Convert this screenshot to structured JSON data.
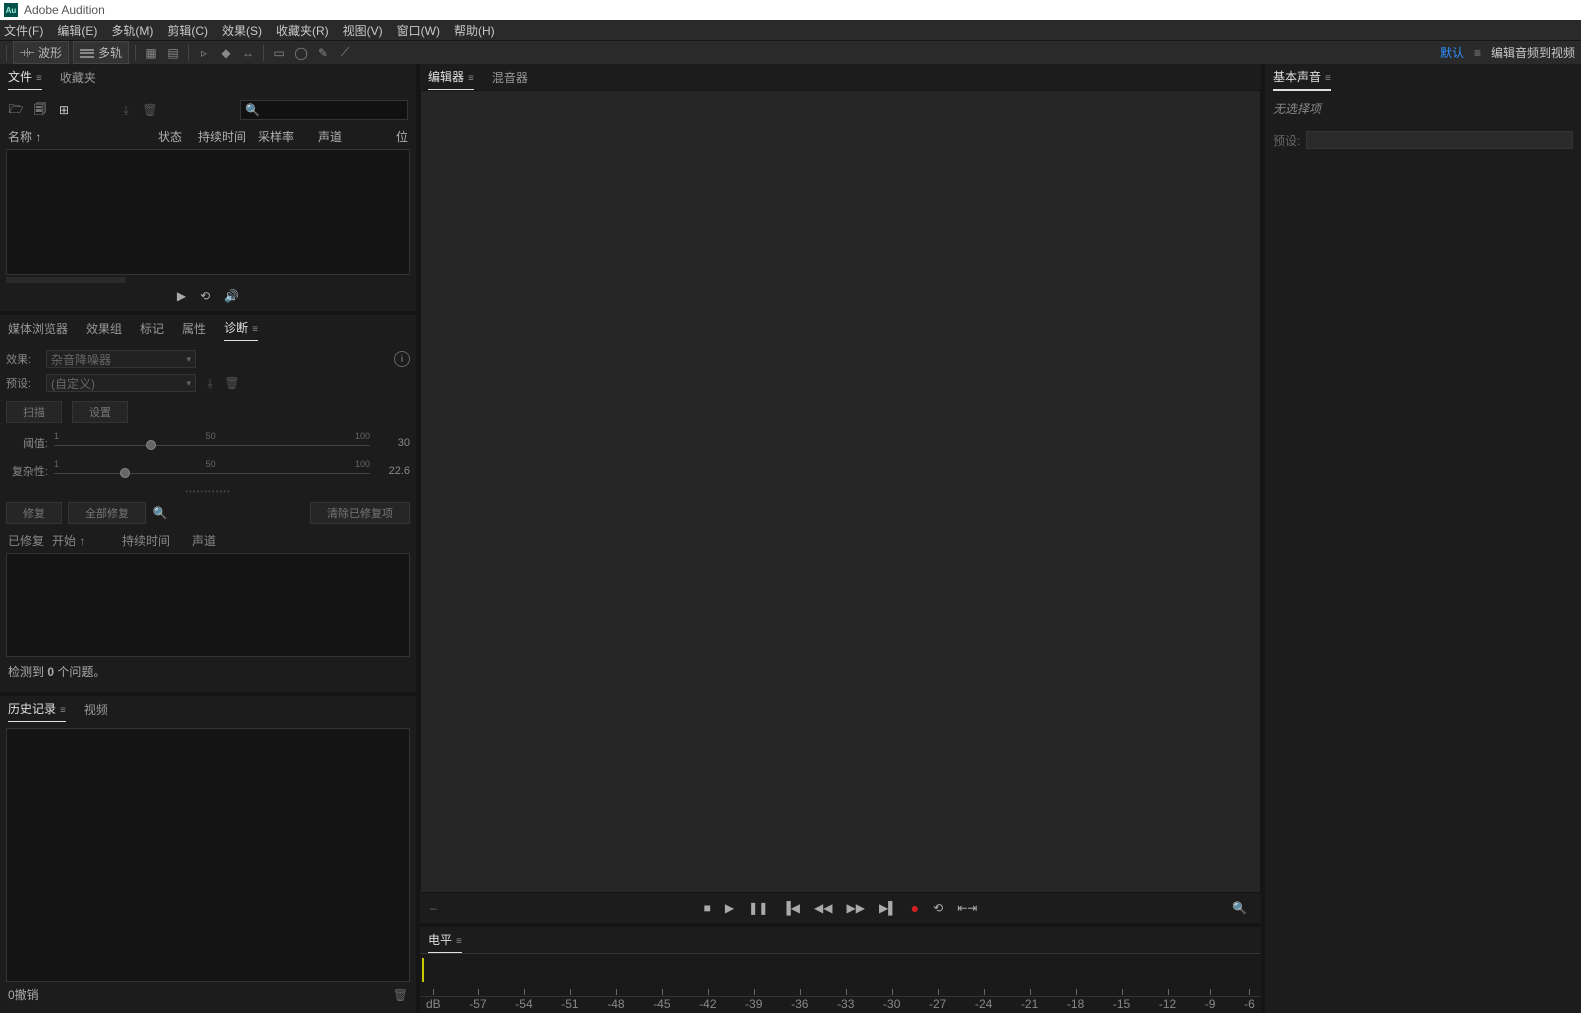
{
  "app": {
    "title": "Adobe Audition",
    "icon_text": "Au"
  },
  "menu": [
    "文件(F)",
    "编辑(E)",
    "多轨(M)",
    "剪辑(C)",
    "效果(S)",
    "收藏夹(R)",
    "视图(V)",
    "窗口(W)",
    "帮助(H)"
  ],
  "toolbar": {
    "waveform": "波形",
    "multitrack": "多轨"
  },
  "workspace": {
    "default": "默认",
    "edit_audio_video": "编辑音频到视频"
  },
  "files_panel": {
    "tabs": {
      "files": "文件",
      "favorites": "收藏夹"
    },
    "cols": {
      "name": "名称 ↑",
      "status": "状态",
      "duration": "持续时间",
      "sample_rate": "采样率",
      "channels": "声道",
      "bit": "位"
    },
    "search_placeholder": ""
  },
  "bottom_tabs": {
    "media_browser": "媒体浏览器",
    "effects_rack": "效果组",
    "markers": "标记",
    "properties": "属性",
    "diagnostics": "诊断"
  },
  "diagnostics": {
    "effect_label": "效果:",
    "effect_value": "杂音降噪器",
    "preset_label": "预设:",
    "preset_value": "(自定义)",
    "scan": "扫描",
    "settings": "设置",
    "threshold_label": "阈值:",
    "threshold_ticks": [
      "1",
      "50",
      "100"
    ],
    "threshold_value": "30",
    "complexity_label": "复杂性:",
    "complexity_ticks": [
      "1",
      "50",
      "100"
    ],
    "complexity_value": "22.6",
    "fix": "修复",
    "fix_all": "全部修复",
    "clear_fixed": "清除已修复项",
    "fix_cols": {
      "fixed": "已修复",
      "start": "开始 ↑",
      "duration": "持续时间",
      "channel": "声道"
    },
    "detected_msg_pre": "检测到 ",
    "detected_count": "0",
    "detected_msg_post": " 个问题。"
  },
  "history_panel": {
    "tabs": {
      "history": "历史记录",
      "video": "视频"
    },
    "undo_count": "0撤销"
  },
  "editor_panel": {
    "tabs": {
      "editor": "编辑器",
      "mixer": "混音器"
    }
  },
  "levels_panel": {
    "tab": "电平",
    "db_label": "dB",
    "db_ticks": [
      "-57",
      "-54",
      "-51",
      "-48",
      "-45",
      "-42",
      "-39",
      "-36",
      "-33",
      "-30",
      "-27",
      "-24",
      "-21",
      "-18",
      "-15",
      "-12",
      "-9",
      "-6"
    ]
  },
  "essential_sound": {
    "tab": "基本声音",
    "no_selection": "无选择项",
    "preset_label": "预设:"
  }
}
